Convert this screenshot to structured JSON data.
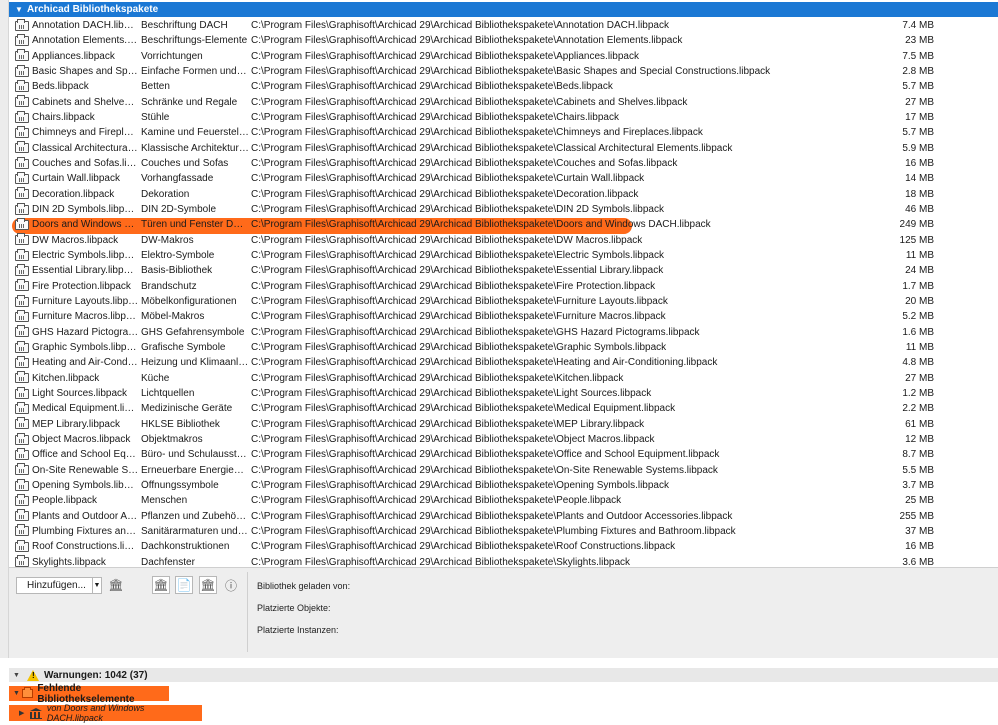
{
  "group": {
    "title": "Archicad Bibliothekspakete",
    "expanded": true
  },
  "libraries": [
    {
      "name": "Annotation DACH.libpack",
      "desc": "Beschriftung DACH",
      "path": "C:\\Program Files\\Graphisoft\\Archicad 29\\Archicad Bibliothekspakete\\Annotation DACH.libpack",
      "size": "7.4 MB"
    },
    {
      "name": "Annotation Elements.libpack",
      "desc": "Beschriftungs-Elemente",
      "path": "C:\\Program Files\\Graphisoft\\Archicad 29\\Archicad Bibliothekspakete\\Annotation Elements.libpack",
      "size": "23 MB"
    },
    {
      "name": "Appliances.libpack",
      "desc": "Vorrichtungen",
      "path": "C:\\Program Files\\Graphisoft\\Archicad 29\\Archicad Bibliothekspakete\\Appliances.libpack",
      "size": "7.5 MB"
    },
    {
      "name": "Basic Shapes and Special C…",
      "desc": "Einfache Formen und Sond…",
      "path": "C:\\Program Files\\Graphisoft\\Archicad 29\\Archicad Bibliothekspakete\\Basic Shapes and Special Constructions.libpack",
      "size": "2.8 MB"
    },
    {
      "name": "Beds.libpack",
      "desc": "Betten",
      "path": "C:\\Program Files\\Graphisoft\\Archicad 29\\Archicad Bibliothekspakete\\Beds.libpack",
      "size": "5.7 MB"
    },
    {
      "name": "Cabinets and Shelves.libpack",
      "desc": "Schränke und Regale",
      "path": "C:\\Program Files\\Graphisoft\\Archicad 29\\Archicad Bibliothekspakete\\Cabinets and Shelves.libpack",
      "size": "27 MB"
    },
    {
      "name": "Chairs.libpack",
      "desc": "Stühle",
      "path": "C:\\Program Files\\Graphisoft\\Archicad 29\\Archicad Bibliothekspakete\\Chairs.libpack",
      "size": "17 MB"
    },
    {
      "name": "Chimneys and Fireplaces.lib…",
      "desc": "Kamine und Feuerstellen",
      "path": "C:\\Program Files\\Graphisoft\\Archicad 29\\Archicad Bibliothekspakete\\Chimneys and Fireplaces.libpack",
      "size": "5.7 MB"
    },
    {
      "name": "Classical Architectural Elem…",
      "desc": "Klassische Architekturelem…",
      "path": "C:\\Program Files\\Graphisoft\\Archicad 29\\Archicad Bibliothekspakete\\Classical Architectural Elements.libpack",
      "size": "5.9 MB"
    },
    {
      "name": "Couches and Sofas.libpack",
      "desc": "Couches und Sofas",
      "path": "C:\\Program Files\\Graphisoft\\Archicad 29\\Archicad Bibliothekspakete\\Couches and Sofas.libpack",
      "size": "16 MB"
    },
    {
      "name": "Curtain Wall.libpack",
      "desc": "Vorhangfassade",
      "path": "C:\\Program Files\\Graphisoft\\Archicad 29\\Archicad Bibliothekspakete\\Curtain Wall.libpack",
      "size": "14 MB"
    },
    {
      "name": "Decoration.libpack",
      "desc": "Dekoration",
      "path": "C:\\Program Files\\Graphisoft\\Archicad 29\\Archicad Bibliothekspakete\\Decoration.libpack",
      "size": "18 MB"
    },
    {
      "name": "DIN 2D Symbols.libpack",
      "desc": "DIN 2D-Symbole",
      "path": "C:\\Program Files\\Graphisoft\\Archicad 29\\Archicad Bibliothekspakete\\DIN 2D Symbols.libpack",
      "size": "46 MB"
    },
    {
      "name": "Doors and Windows DACH…",
      "desc": "Türen und Fenster DACH",
      "path": "C:\\Program Files\\Graphisoft\\Archicad 29\\Archicad Bibliothekspakete\\Doors and Windows DACH.libpack",
      "size": "249 MB"
    },
    {
      "name": "DW Macros.libpack",
      "desc": "DW-Makros",
      "path": "C:\\Program Files\\Graphisoft\\Archicad 29\\Archicad Bibliothekspakete\\DW Macros.libpack",
      "size": "125 MB"
    },
    {
      "name": "Electric Symbols.libpack",
      "desc": "Elektro-Symbole",
      "path": "C:\\Program Files\\Graphisoft\\Archicad 29\\Archicad Bibliothekspakete\\Electric Symbols.libpack",
      "size": "11 MB"
    },
    {
      "name": "Essential Library.libpack",
      "desc": "Basis-Bibliothek",
      "path": "C:\\Program Files\\Graphisoft\\Archicad 29\\Archicad Bibliothekspakete\\Essential Library.libpack",
      "size": "24 MB"
    },
    {
      "name": "Fire Protection.libpack",
      "desc": "Brandschutz",
      "path": "C:\\Program Files\\Graphisoft\\Archicad 29\\Archicad Bibliothekspakete\\Fire Protection.libpack",
      "size": "1.7 MB"
    },
    {
      "name": "Furniture Layouts.libpack",
      "desc": "Möbelkonfigurationen",
      "path": "C:\\Program Files\\Graphisoft\\Archicad 29\\Archicad Bibliothekspakete\\Furniture Layouts.libpack",
      "size": "20 MB"
    },
    {
      "name": "Furniture Macros.libpack",
      "desc": "Möbel-Makros",
      "path": "C:\\Program Files\\Graphisoft\\Archicad 29\\Archicad Bibliothekspakete\\Furniture Macros.libpack",
      "size": "5.2 MB"
    },
    {
      "name": "GHS Hazard Pictograms.lib…",
      "desc": "GHS Gefahrensymbole",
      "path": "C:\\Program Files\\Graphisoft\\Archicad 29\\Archicad Bibliothekspakete\\GHS Hazard Pictograms.libpack",
      "size": "1.6 MB"
    },
    {
      "name": "Graphic Symbols.libpack",
      "desc": "Grafische Symbole",
      "path": "C:\\Program Files\\Graphisoft\\Archicad 29\\Archicad Bibliothekspakete\\Graphic Symbols.libpack",
      "size": "11 MB"
    },
    {
      "name": "Heating and Air-Conditioni…",
      "desc": "Heizung und Klimaanlagen",
      "path": "C:\\Program Files\\Graphisoft\\Archicad 29\\Archicad Bibliothekspakete\\Heating and Air-Conditioning.libpack",
      "size": "4.8 MB"
    },
    {
      "name": "Kitchen.libpack",
      "desc": "Küche",
      "path": "C:\\Program Files\\Graphisoft\\Archicad 29\\Archicad Bibliothekspakete\\Kitchen.libpack",
      "size": "27 MB"
    },
    {
      "name": "Light Sources.libpack",
      "desc": "Lichtquellen",
      "path": "C:\\Program Files\\Graphisoft\\Archicad 29\\Archicad Bibliothekspakete\\Light Sources.libpack",
      "size": "1.2 MB"
    },
    {
      "name": "Medical Equipment.libpack",
      "desc": "Medizinische Geräte",
      "path": "C:\\Program Files\\Graphisoft\\Archicad 29\\Archicad Bibliothekspakete\\Medical Equipment.libpack",
      "size": "2.2 MB"
    },
    {
      "name": "MEP Library.libpack",
      "desc": "HKLSE Bibliothek",
      "path": "C:\\Program Files\\Graphisoft\\Archicad 29\\Archicad Bibliothekspakete\\MEP Library.libpack",
      "size": "61 MB"
    },
    {
      "name": "Object Macros.libpack",
      "desc": "Objektmakros",
      "path": "C:\\Program Files\\Graphisoft\\Archicad 29\\Archicad Bibliothekspakete\\Object Macros.libpack",
      "size": "12 MB"
    },
    {
      "name": "Office and School Equipme…",
      "desc": "Büro- und Schulausstattung",
      "path": "C:\\Program Files\\Graphisoft\\Archicad 29\\Archicad Bibliothekspakete\\Office and School Equipment.libpack",
      "size": "8.7 MB"
    },
    {
      "name": "On-Site Renewable System…",
      "desc": "Erneuerbare Energiequelle…",
      "path": "C:\\Program Files\\Graphisoft\\Archicad 29\\Archicad Bibliothekspakete\\On-Site Renewable Systems.libpack",
      "size": "5.5 MB"
    },
    {
      "name": "Opening Symbols.libpack",
      "desc": "Öffnungssymbole",
      "path": "C:\\Program Files\\Graphisoft\\Archicad 29\\Archicad Bibliothekspakete\\Opening Symbols.libpack",
      "size": "3.7 MB"
    },
    {
      "name": "People.libpack",
      "desc": "Menschen",
      "path": "C:\\Program Files\\Graphisoft\\Archicad 29\\Archicad Bibliothekspakete\\People.libpack",
      "size": "25 MB"
    },
    {
      "name": "Plants and Outdoor Access…",
      "desc": "Pflanzen und Zubehör für …",
      "path": "C:\\Program Files\\Graphisoft\\Archicad 29\\Archicad Bibliothekspakete\\Plants and Outdoor Accessories.libpack",
      "size": "255 MB"
    },
    {
      "name": "Plumbing Fixtures and Bat…",
      "desc": "Sanitärarmaturen und Bad",
      "path": "C:\\Program Files\\Graphisoft\\Archicad 29\\Archicad Bibliothekspakete\\Plumbing Fixtures and Bathroom.libpack",
      "size": "37 MB"
    },
    {
      "name": "Roof Constructions.libpack",
      "desc": "Dachkonstruktionen",
      "path": "C:\\Program Files\\Graphisoft\\Archicad 29\\Archicad Bibliothekspakete\\Roof Constructions.libpack",
      "size": "16 MB"
    },
    {
      "name": "Skylights.libpack",
      "desc": "Dachfenster",
      "path": "C:\\Program Files\\Graphisoft\\Archicad 29\\Archicad Bibliothekspakete\\Skylights.libpack",
      "size": "3.6 MB"
    }
  ],
  "highlighted_row": 13,
  "toolbar": {
    "add_label": "Hinzufügen...",
    "icons": [
      "library-icon",
      "library-manager-icon",
      "document-icon",
      "archive-icon",
      "info-icon"
    ]
  },
  "info_panel": {
    "loaded_from_label": "Bibliothek geladen von:",
    "placed_objects_label": "Platzierte Objekte:",
    "placed_instances_label": "Platzierte Instanzen:"
  },
  "warnings": {
    "label": "Warnungen: 1042 (37)",
    "missing_label": "Fehlende Bibliothekselemente",
    "from_label": "von Doors and Windows DACH.libpack"
  },
  "colors": {
    "selection_blue": "#1b78d4",
    "annotation_orange": "#ff6a1a",
    "warning_yellow": "#f4c300"
  }
}
